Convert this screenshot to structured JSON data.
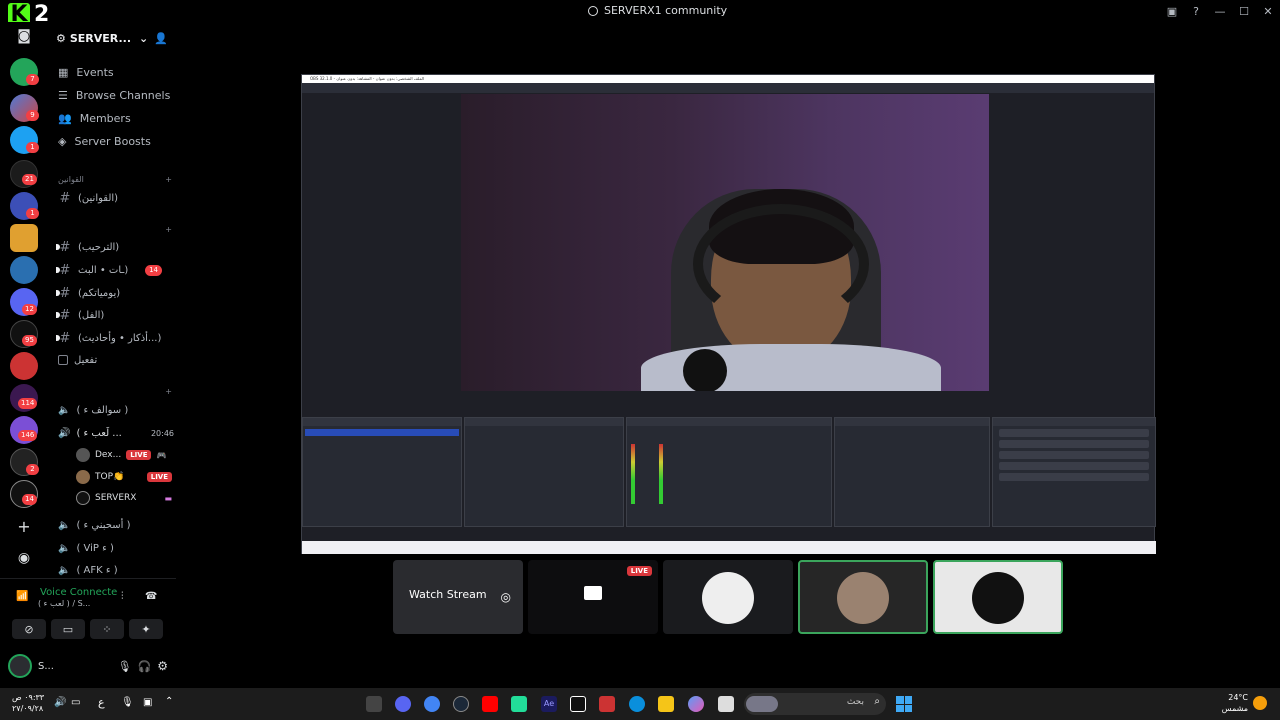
{
  "window": {
    "title": "SERVERX1 community",
    "logo_letter": "K",
    "logo_number": "2"
  },
  "rail": {
    "badges": [
      "7",
      "9",
      "1",
      "21",
      "1",
      "12",
      "95",
      "114",
      "146",
      "2",
      "14"
    ]
  },
  "server": {
    "name": "SERVER...",
    "menu": [
      "Events",
      "Browse Channels",
      "Members",
      "Server Boosts"
    ]
  },
  "categories": [
    {
      "label": "القوانين"
    }
  ],
  "text_channels": [
    {
      "label": "(القوانين)"
    },
    {
      "label": "(الترحيب)"
    },
    {
      "label": "ـات • البث)",
      "badge": "14"
    },
    {
      "label": "(يومياتكم)"
    },
    {
      "label": "(الفل)"
    },
    {
      "label": "(أذكار • وأحاديث...)"
    },
    {
      "label": "تفعيل"
    }
  ],
  "voice_channels": [
    {
      "label": "( سوالف ﺀ )"
    },
    {
      "label": "( لَعب ﺀ ...",
      "time": "20:46"
    },
    {
      "label": "( أسحبني ﺀ )"
    },
    {
      "label": "( ViP ﺀ )"
    },
    {
      "label": "( AFK ﺀ )"
    }
  ],
  "voice_users": [
    {
      "name": "Dex...",
      "live": "LIVE"
    },
    {
      "name": "TOP👏",
      "live": "LIVE"
    },
    {
      "name": "SERVERX",
      "live": ""
    }
  ],
  "voice_panel": {
    "status": "Voice Connecte",
    "sub": "( لعب ﺀ ) / S...",
    "user": "S..."
  },
  "stage": {
    "obs_title": "OBS 32.1.0 - الملف الشخصي: بدون عنوان - المشاهد: بدون عنوان",
    "tiles": [
      {
        "label": "Watch Stream"
      },
      {
        "live": "LIVE"
      }
    ]
  },
  "taskbar": {
    "time": "٠٩:٣٣ ص",
    "date": "٢٧/٠٩/٢٨",
    "lang": "ع",
    "search_placeholder": "بحث",
    "weather_temp": "24°C",
    "weather_desc": "مشمس"
  },
  "colors": {
    "green": "#23a55a",
    "red": "#f23f43",
    "kick": "#53fc18"
  }
}
